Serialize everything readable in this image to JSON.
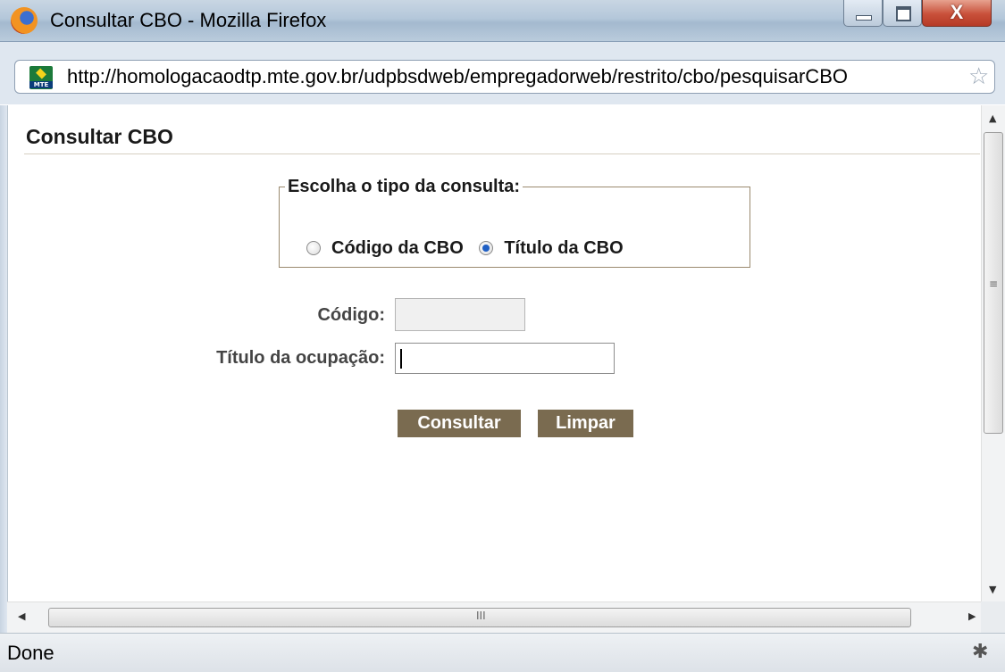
{
  "window": {
    "title": "Consultar CBO - Mozilla Firefox",
    "close_glyph": "X"
  },
  "address_bar": {
    "url": "http://homologacaodtp.mte.gov.br/udpbsdweb/empregadorweb/restrito/cbo/pesquisarCBO",
    "site_icon_label": "MTE",
    "star_glyph": "☆"
  },
  "page": {
    "title": "Consultar CBO",
    "fieldset_legend": "Escolha o tipo da consulta:",
    "radio_options": [
      {
        "label": "Código da CBO",
        "checked": false
      },
      {
        "label": "Título da CBO",
        "checked": true
      }
    ],
    "fields": {
      "codigo_label": "Código:",
      "codigo_value": "",
      "titulo_label": "Título da ocupação:",
      "titulo_value": ""
    },
    "buttons": {
      "consultar": "Consultar",
      "limpar": "Limpar"
    }
  },
  "scrollbars": {
    "up": "▲",
    "down": "▼",
    "left": "◀",
    "right": "▶",
    "v_grip": "≡",
    "h_grip": "III"
  },
  "status_bar": {
    "text": "Done"
  },
  "colors": {
    "button_bg": "#7a6b50",
    "fieldset_border": "#9a8a6f",
    "radio_checked": "#1f5fc4"
  },
  "icons": {
    "browser_logo": "firefox-icon",
    "site": "mte-site-icon",
    "bookmark": "star-icon",
    "status": "bug-icon"
  }
}
